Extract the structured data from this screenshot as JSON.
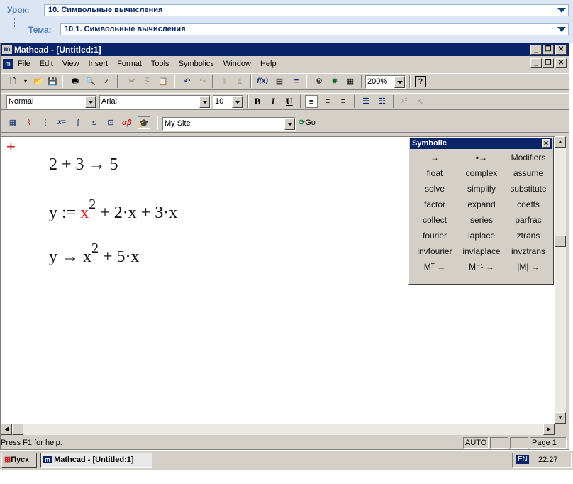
{
  "lesson": {
    "lesson_label": "Урок:",
    "lesson_value": "10. Символьные вычисления",
    "topic_label": "Тема:",
    "topic_value": "10.1. Символьные вычисления"
  },
  "window": {
    "title": "Mathcad - [Untitled:1]"
  },
  "menu": [
    "File",
    "Edit",
    "View",
    "Insert",
    "Format",
    "Tools",
    "Symbolics",
    "Window",
    "Help"
  ],
  "toolbar": {
    "zoom": "200%"
  },
  "format_bar": {
    "style": "Normal",
    "font": "Arial",
    "size": "10",
    "bold": "B",
    "italic": "I",
    "underline": "U"
  },
  "resource_bar": {
    "site": "My Site",
    "go": "Go"
  },
  "worksheet": {
    "line1": {
      "a": "2",
      "op": "+",
      "b": "3",
      "arrow": "→",
      "result": "5"
    },
    "line2": {
      "lhs": "y",
      "assign": ":=",
      "x": "x",
      "exp": "2",
      "rest": "+ 2·x + 3·x"
    },
    "line3": {
      "lhs": "y",
      "arrow": "→",
      "x": "x",
      "exp": "2",
      "rest": "+ 5·x"
    }
  },
  "palette": {
    "title": "Symbolic",
    "buttons": [
      "→",
      "▪→",
      "Modifiers",
      "float",
      "complex",
      "assume",
      "solve",
      "simplify",
      "substitute",
      "factor",
      "expand",
      "coeffs",
      "collect",
      "series",
      "parfrac",
      "fourier",
      "laplace",
      "ztrans",
      "invfourier",
      "invlaplace",
      "invztrans",
      "Mᵀ →",
      "M⁻¹ →",
      "|M| →"
    ]
  },
  "status": {
    "help": "Press F1 for help.",
    "mode": "AUTO",
    "page": "Page 1"
  },
  "taskbar": {
    "start": "Пуск",
    "task": "Mathcad - [Untitled:1]",
    "lang": "EN",
    "time": "22:27"
  },
  "colors": {
    "title_bar": "#0a246a",
    "highlight_var": "#d02020",
    "lesson_bar": "#dce5f3",
    "label_blue": "#4f7fbf"
  }
}
